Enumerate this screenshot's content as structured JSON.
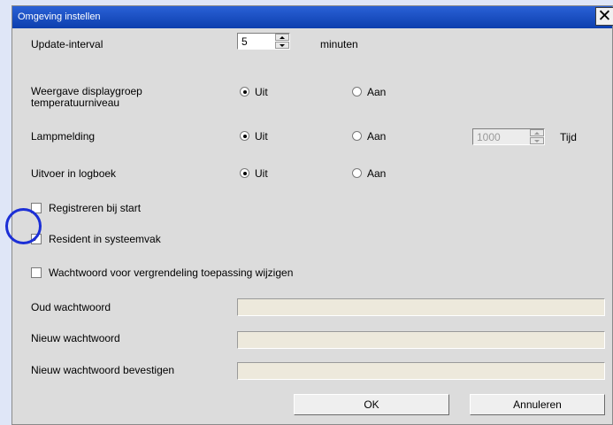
{
  "dialog": {
    "title": "Omgeving instellen",
    "close_glyph": "✕"
  },
  "update_interval": {
    "label": "Update-interval",
    "value": "5",
    "unit": "minuten"
  },
  "display_group_temp": {
    "label": "Weergave displaygroep temperatuurniveau",
    "option_off": "Uit",
    "option_on": "Aan",
    "selected": "Uit"
  },
  "lamp_notice": {
    "label": "Lampmelding",
    "option_off": "Uit",
    "option_on": "Aan",
    "selected": "Uit",
    "time_value": "1000",
    "time_label": "Tijd"
  },
  "log_output": {
    "label": "Uitvoer in logboek",
    "option_off": "Uit",
    "option_on": "Aan",
    "selected": "Uit"
  },
  "checkboxes": {
    "register_at_start": {
      "label": "Registreren bij start",
      "checked": false
    },
    "resident_systray": {
      "label": "Resident in systeemvak",
      "checked": true,
      "mark": "✓"
    },
    "change_password": {
      "label": "Wachtwoord voor vergrendeling toepassing wijzigen",
      "checked": false
    }
  },
  "password_fields": {
    "old_label": "Oud wachtwoord",
    "new_label": "Nieuw wachtwoord",
    "confirm_label": "Nieuw wachtwoord bevestigen"
  },
  "buttons": {
    "ok": "OK",
    "cancel": "Annuleren"
  },
  "colors": {
    "titlebar": "#0d3fae",
    "highlight_ring": "#1c2fd6",
    "dialog_bg": "#dcdcdc"
  }
}
